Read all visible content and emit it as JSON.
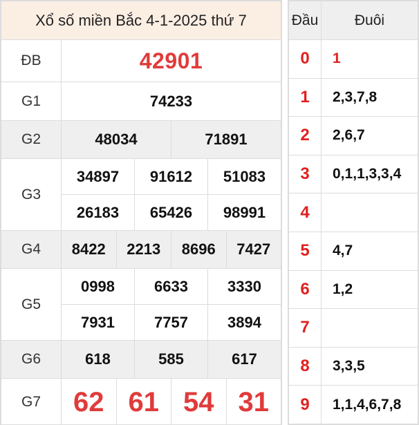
{
  "title": "Xổ số miền Bắc 4-1-2025 thứ 7",
  "prizes": {
    "db": {
      "label": "ĐB",
      "numbers": [
        "42901"
      ]
    },
    "g1": {
      "label": "G1",
      "numbers": [
        "74233"
      ]
    },
    "g2": {
      "label": "G2",
      "numbers": [
        "48034",
        "71891"
      ]
    },
    "g3": {
      "label": "G3",
      "numbers": [
        "34897",
        "91612",
        "51083",
        "26183",
        "65426",
        "98991"
      ]
    },
    "g4": {
      "label": "G4",
      "numbers": [
        "8422",
        "2213",
        "8696",
        "7427"
      ]
    },
    "g5": {
      "label": "G5",
      "numbers": [
        "0998",
        "6633",
        "3330",
        "7931",
        "7757",
        "3894"
      ]
    },
    "g6": {
      "label": "G6",
      "numbers": [
        "618",
        "585",
        "617"
      ]
    },
    "g7": {
      "label": "G7",
      "numbers": [
        "62",
        "61",
        "54",
        "31"
      ]
    }
  },
  "dau_duoi": {
    "header_dau": "Đầu",
    "header_duoi": "Đuôi",
    "rows": [
      {
        "dau": "0",
        "duoi": "1"
      },
      {
        "dau": "1",
        "duoi": "2,3,7,8"
      },
      {
        "dau": "2",
        "duoi": "2,6,7"
      },
      {
        "dau": "3",
        "duoi": "0,1,1,3,3,4"
      },
      {
        "dau": "4",
        "duoi": ""
      },
      {
        "dau": "5",
        "duoi": "4,7"
      },
      {
        "dau": "6",
        "duoi": "1,2"
      },
      {
        "dau": "7",
        "duoi": ""
      },
      {
        "dau": "8",
        "duoi": "3,3,5"
      },
      {
        "dau": "9",
        "duoi": "1,1,4,6,7,8"
      }
    ]
  },
  "colors": {
    "accent_red": "#e03b3b",
    "title_bg": "#fbeee3",
    "stripe_bg": "#efefef"
  }
}
